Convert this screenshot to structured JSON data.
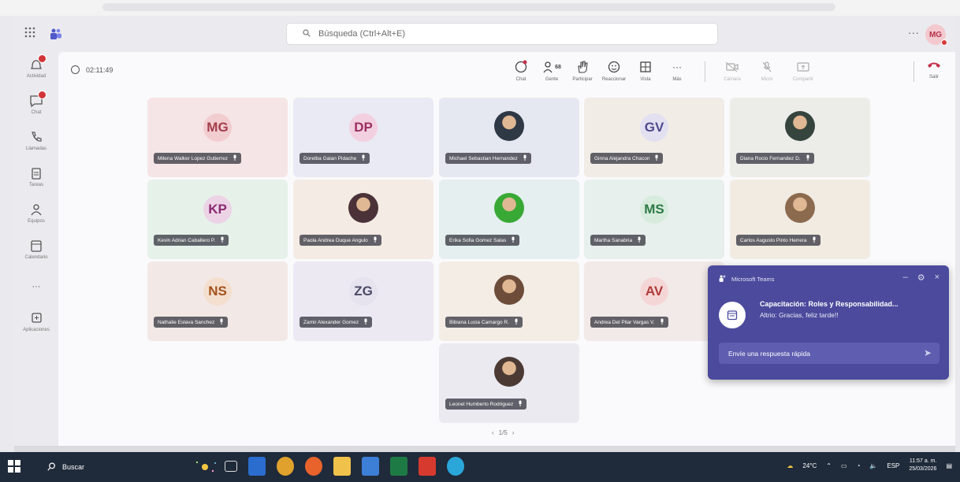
{
  "titlebar": {
    "search_placeholder": "Búsqueda (Ctrl+Alt+E)",
    "more": "···",
    "user_initials": "MG"
  },
  "rail": {
    "items": [
      {
        "label": "Actividad",
        "icon": "bell-icon",
        "badge": true
      },
      {
        "label": "Chat",
        "icon": "chat-icon",
        "badge": true
      },
      {
        "label": "Llamadas",
        "icon": "phone-icon",
        "badge": false
      },
      {
        "label": "Tareas",
        "icon": "clipboard-icon",
        "badge": false
      },
      {
        "label": "Equipos",
        "icon": "teams-icon",
        "badge": false
      },
      {
        "label": "Calendario",
        "icon": "calendar-icon",
        "badge": false
      },
      {
        "label": "···",
        "icon": "more-icon",
        "badge": false
      },
      {
        "label": "Aplicaciones",
        "icon": "add-app-icon",
        "badge": false
      }
    ]
  },
  "meeting": {
    "timer": "02:11:49",
    "toolbar": {
      "chat": "Chat",
      "people": "Gente",
      "people_count": "68",
      "raise": "Participar",
      "react": "Reaccionar",
      "view": "Vista",
      "more": "Más",
      "camera": "Cámara",
      "mic": "Micro",
      "share": "Compartir",
      "leave": "Salir"
    },
    "pager": "1/5"
  },
  "tiles": [
    {
      "initials": "MG",
      "name": "Milena Walker Lopez Gutierrez",
      "bg": "#f6e5e6",
      "circle": "#f2cdd0",
      "fg": "#a33d4a"
    },
    {
      "initials": "DP",
      "name": "Dorelba Gaian Pidache",
      "bg": "#eaeaf4",
      "circle": "#f2d0df",
      "fg": "#9c2f62"
    },
    {
      "initials": "",
      "name": "Michael Sebastian Hernandez",
      "bg": "#e6e8f1",
      "photo": "#2f3845"
    },
    {
      "initials": "GV",
      "name": "Ginna Alejandra Chacon",
      "bg": "#f1ece6",
      "circle": "#e3e0f2",
      "fg": "#4d4a8c"
    },
    {
      "initials": "",
      "name": "Diana Rocio Fernandez D.",
      "bg": "#ecece9",
      "photo": "#35443c"
    },
    {
      "initials": "KP",
      "name": "Kevin Adrian Caballero P.",
      "bg": "#e6f1ea",
      "circle": "#ecd3e6",
      "fg": "#8a2a72"
    },
    {
      "initials": "",
      "name": "Paola Andrea Duque Angulo",
      "bg": "#f3ebe4",
      "photo": "#4a3238"
    },
    {
      "initials": "",
      "name": "Erika Sofia Gomez Salas",
      "bg": "#e5eff0",
      "photo": "#39a935"
    },
    {
      "initials": "MS",
      "name": "Martha Sanabria",
      "bg": "#e7f0ec",
      "circle": "#d7ecdd",
      "fg": "#2d7a45"
    },
    {
      "initials": "",
      "name": "Carlos Augusto Pinto Herrera",
      "bg": "#f1ebe2",
      "photo": "#8b6a4e"
    },
    {
      "initials": "NS",
      "name": "Nathalie Eslava Sanchez",
      "bg": "#f2e9e6",
      "circle": "#f4dfcf",
      "fg": "#a2521b"
    },
    {
      "initials": "ZG",
      "name": "Zamir Alexander Gomez",
      "bg": "#ece9f2",
      "circle": "#e6e3ef",
      "fg": "#4b4a66"
    },
    {
      "initials": "",
      "name": "Bibiana Lucia Camargo R.",
      "bg": "#f3ede6",
      "photo": "#6d4c3a"
    },
    {
      "initials": "AV",
      "name": "Andrea Del Pilar Vargas V.",
      "bg": "#f2eae8",
      "circle": "#f5d6d6",
      "fg": "#b13a3a"
    },
    {
      "initials": "",
      "name": "Leonel Humberto Rodriguez",
      "bg": "#ebeaf1",
      "photo": "#4b3a34"
    }
  ],
  "notification": {
    "app": "Microsoft Teams",
    "title": "Capacitación: Roles y Responsabilidad...",
    "message": "Altrio: Gracias, feliz tarde!!",
    "reply_placeholder": "Envíe una respuesta rápida"
  },
  "taskbar": {
    "search": "Buscar",
    "temperature": "24°C",
    "language": "ESP",
    "time": "11:57 a. m.",
    "date": "25/03/2026"
  },
  "colors": {
    "accent": "#4b4a9c",
    "leave": "#c4314b",
    "taskbar": "#1f2a3a"
  }
}
